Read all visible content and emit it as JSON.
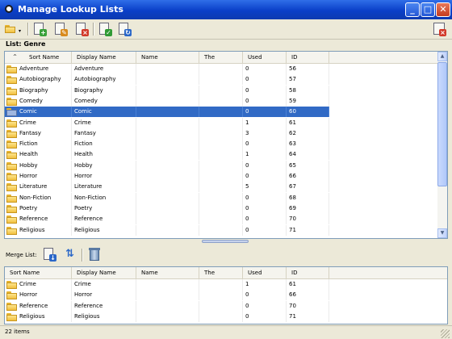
{
  "window": {
    "title": "Manage Lookup Lists",
    "minimize_glyph": "_",
    "maximize_glyph": "□",
    "close_glyph": "✕"
  },
  "toolbar": {
    "icons": [
      "open-folder-icon",
      "add-item-icon",
      "edit-item-icon",
      "delete-item-icon",
      "check-item-icon",
      "refresh-item-icon",
      "close-panel-icon"
    ]
  },
  "list": {
    "label": "List: Genre"
  },
  "columns": [
    "Sort Name",
    "Display Name",
    "Name",
    "The",
    "Used",
    "ID"
  ],
  "sort_indicator": "^",
  "rows": [
    {
      "sort": "Adventure",
      "display": "Adventure",
      "name": "",
      "the": "",
      "used": "0",
      "id": "56"
    },
    {
      "sort": "Autobiography",
      "display": "Autobiography",
      "name": "",
      "the": "",
      "used": "0",
      "id": "57"
    },
    {
      "sort": "Biography",
      "display": "Biography",
      "name": "",
      "the": "",
      "used": "0",
      "id": "58"
    },
    {
      "sort": "Comedy",
      "display": "Comedy",
      "name": "",
      "the": "",
      "used": "0",
      "id": "59"
    },
    {
      "sort": "Comic",
      "display": "Comic",
      "name": "",
      "the": "",
      "used": "0",
      "id": "60",
      "selected": true
    },
    {
      "sort": "Crime",
      "display": "Crime",
      "name": "",
      "the": "",
      "used": "1",
      "id": "61"
    },
    {
      "sort": "Fantasy",
      "display": "Fantasy",
      "name": "",
      "the": "",
      "used": "3",
      "id": "62"
    },
    {
      "sort": "Fiction",
      "display": "Fiction",
      "name": "",
      "the": "",
      "used": "0",
      "id": "63"
    },
    {
      "sort": "Health",
      "display": "Health",
      "name": "",
      "the": "",
      "used": "1",
      "id": "64"
    },
    {
      "sort": "Hobby",
      "display": "Hobby",
      "name": "",
      "the": "",
      "used": "0",
      "id": "65"
    },
    {
      "sort": "Horror",
      "display": "Horror",
      "name": "",
      "the": "",
      "used": "0",
      "id": "66"
    },
    {
      "sort": "Literature",
      "display": "Literature",
      "name": "",
      "the": "",
      "used": "5",
      "id": "67"
    },
    {
      "sort": "Non-Fiction",
      "display": "Non-Fiction",
      "name": "",
      "the": "",
      "used": "0",
      "id": "68"
    },
    {
      "sort": "Poetry",
      "display": "Poetry",
      "name": "",
      "the": "",
      "used": "0",
      "id": "69"
    },
    {
      "sort": "Reference",
      "display": "Reference",
      "name": "",
      "the": "",
      "used": "0",
      "id": "70"
    },
    {
      "sort": "Religious",
      "display": "Religious",
      "name": "",
      "the": "",
      "used": "0",
      "id": "71"
    }
  ],
  "merge": {
    "label": "Merge List:",
    "icons": [
      "merge-list-icon",
      "merge-run-icon",
      "trash-icon"
    ],
    "rows": [
      {
        "sort": "Crime",
        "display": "Crime",
        "name": "",
        "the": "",
        "used": "1",
        "id": "61"
      },
      {
        "sort": "Horror",
        "display": "Horror",
        "name": "",
        "the": "",
        "used": "0",
        "id": "66"
      },
      {
        "sort": "Reference",
        "display": "Reference",
        "name": "",
        "the": "",
        "used": "0",
        "id": "70"
      },
      {
        "sort": "Religious",
        "display": "Religious",
        "name": "",
        "the": "",
        "used": "0",
        "id": "71"
      }
    ]
  },
  "status": {
    "text": "22 items"
  },
  "colors": {
    "title_bar": "#0a3fc8",
    "selection": "#316ac5",
    "folder": "#f2c040",
    "background": "#ece9d8"
  }
}
